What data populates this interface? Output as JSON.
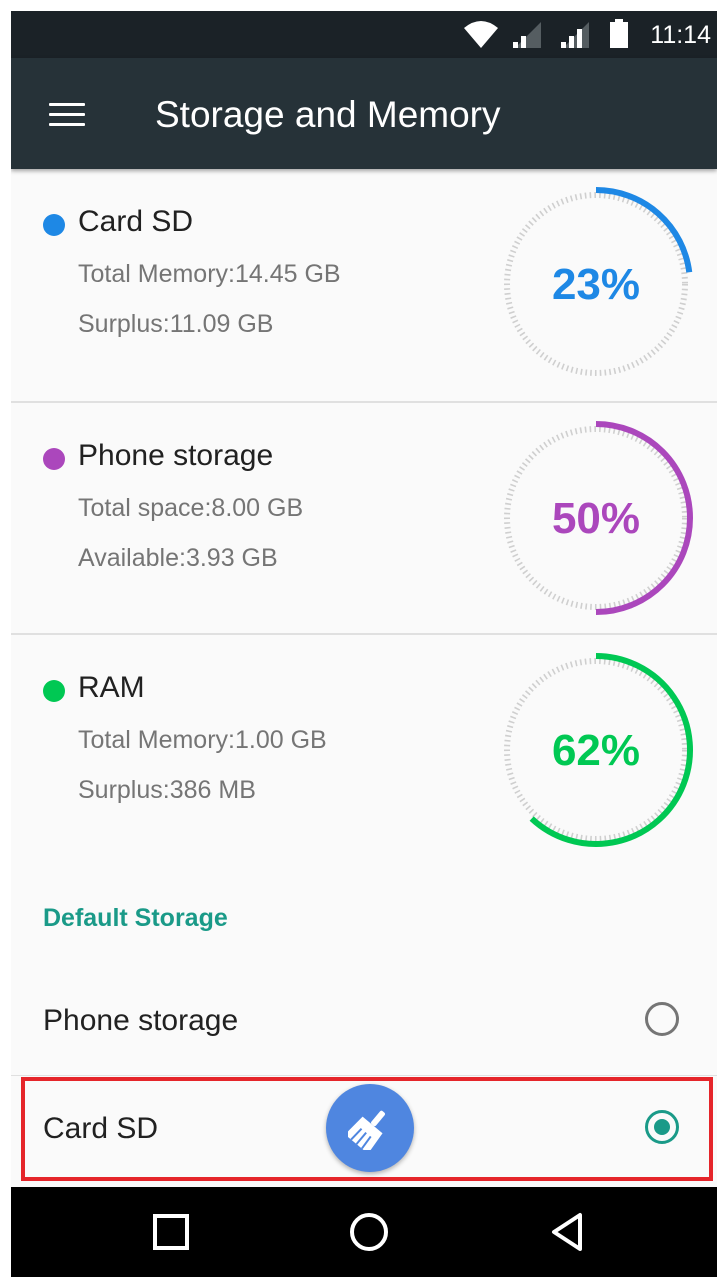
{
  "status_bar": {
    "time": "11:14",
    "icons": [
      "wifi-icon",
      "signal-icon",
      "signal-icon",
      "battery-icon"
    ]
  },
  "app_bar": {
    "menu_icon": "hamburger-menu-icon",
    "title": "Storage and Memory"
  },
  "storage_items": [
    {
      "name": "Card SD",
      "line1": "Total Memory:14.45 GB",
      "line2": "Surplus:11.09 GB",
      "percent_label": "23%",
      "percent": 23,
      "color": "#1e88e5"
    },
    {
      "name": "Phone storage",
      "line1": "Total space:8.00 GB",
      "line2": "Available:3.93 GB",
      "percent_label": "50%",
      "percent": 50,
      "color": "#ab47bc"
    },
    {
      "name": "RAM",
      "line1": "Total Memory:1.00 GB",
      "line2": "Surplus:386 MB",
      "percent_label": "62%",
      "percent": 62,
      "color": "#00c853"
    }
  ],
  "default_storage": {
    "heading": "Default Storage",
    "options": [
      {
        "label": "Phone storage",
        "selected": false
      },
      {
        "label": "Card SD",
        "selected": true
      }
    ]
  },
  "fab": {
    "icon": "broom-clean-icon"
  },
  "nav_bar": {
    "buttons": [
      "recents-square-icon",
      "home-circle-icon",
      "back-triangle-icon"
    ]
  },
  "colors": {
    "status_bar": "#1b2227",
    "app_bar": "#263238",
    "accent": "#1a9a88",
    "highlight": "#e5252a",
    "fab": "#4f86e0"
  }
}
